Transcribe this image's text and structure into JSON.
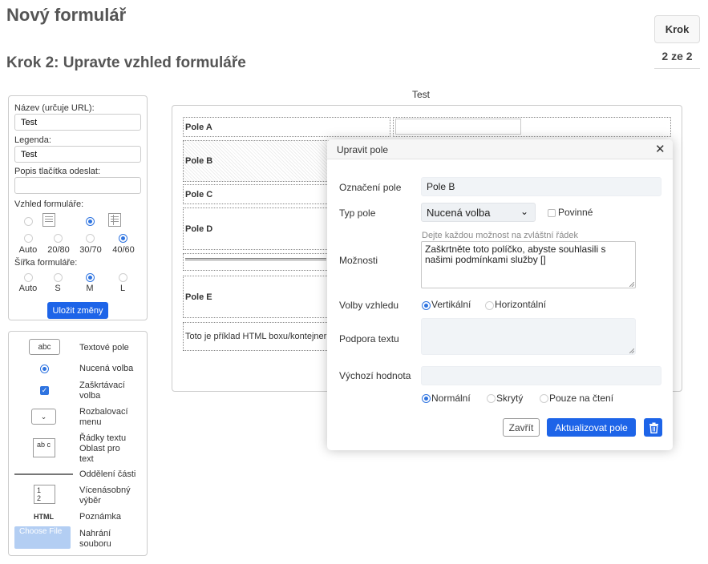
{
  "page_title": "Nový formulář",
  "step_title": "Krok 2: Upravte vzhled formuláře",
  "step_indicator": {
    "label": "Krok",
    "count": "2 ze 2"
  },
  "settings": {
    "name_label": "Název (určuje URL):",
    "name_value": "Test",
    "legend_label": "Legenda:",
    "legend_value": "Test",
    "submit_label": "Popis tlačítka odeslat:",
    "submit_value": "",
    "layout_label": "Vzhled formuláře:",
    "layout_options": [
      "Auto",
      "20/80",
      "30/70",
      "40/60"
    ],
    "layout_selected": "40/60",
    "width_label": "Šířka formuláře:",
    "width_options": [
      "Auto",
      "S",
      "M",
      "L"
    ],
    "width_selected": "M",
    "save_button": "Uložit změny"
  },
  "palette": {
    "text_field_sample": "abc",
    "textarea_sample": "ab c",
    "multiselect_sample": [
      "1",
      "2"
    ],
    "html_sample": "HTML",
    "file_sample": "Choose File",
    "items": [
      "Textové pole",
      "Nucená volba",
      "Zaškrtávací volba",
      "Rozbalovací menu",
      "Řádky textu Oblast pro text",
      "Oddělení části",
      "Vícenásobný výběr",
      "Poznámka",
      "Nahrání souboru"
    ]
  },
  "form_preview": {
    "title": "Test",
    "fields": [
      "Pole A",
      "Pole B",
      "Pole C",
      "Pole D",
      "",
      "Pole E"
    ],
    "html_box_text": "Toto je příklad HTML boxu/kontejneru"
  },
  "modal": {
    "title": "Upravit pole",
    "label_field_label": "Označení pole",
    "label_field_value": "Pole B",
    "type_label": "Typ pole",
    "type_value": "Nucená volba",
    "required_label": "Povinné",
    "options_hint": "Dejte každou možnost na zvláštní řádek",
    "options_label": "Možnosti",
    "options_value": "Zaškrtněte toto políčko, abyste souhlasili s našimi podmínkami služby []",
    "appearance_label": "Volby vzhledu",
    "appearance_options": [
      "Vertikální",
      "Horizontální"
    ],
    "appearance_selected": "Vertikální",
    "help_label": "Podpora textu",
    "help_value": "",
    "default_label": "Výchozí hodnota",
    "default_value": "",
    "visibility_options": [
      "Normální",
      "Skrytý",
      "Pouze na čtení"
    ],
    "visibility_selected": "Normální",
    "close_button": "Zavřít",
    "update_button": "Aktualizovat pole"
  },
  "colors": {
    "accent": "#1d64e8",
    "border": "#cccccc",
    "heading": "#555555"
  }
}
